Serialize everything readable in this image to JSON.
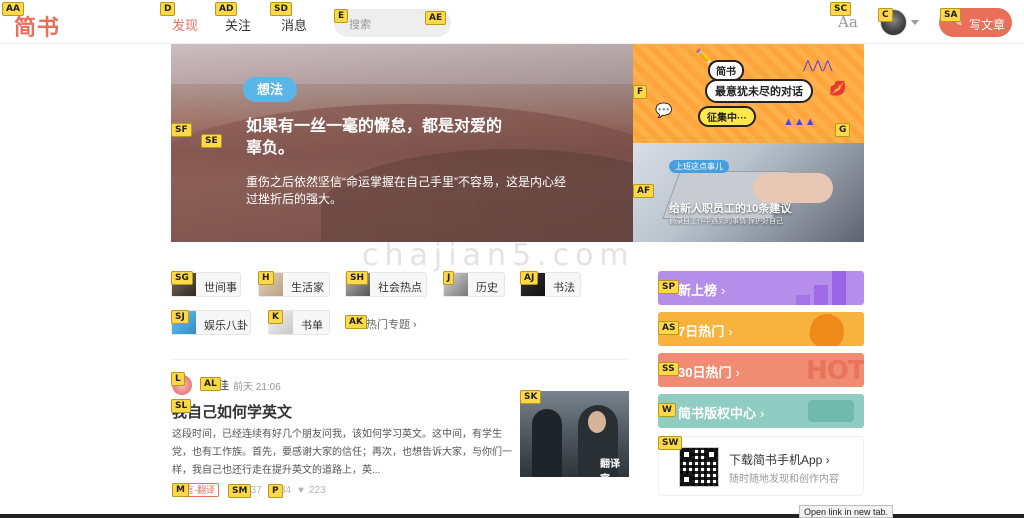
{
  "header": {
    "logo": "简书",
    "nav": {
      "discover": "发现",
      "follow": "关注",
      "messages": "消息"
    },
    "search": {
      "placeholder": "搜索"
    },
    "font_toggle": "Aa",
    "write_button": "写文章"
  },
  "hints": {
    "logo": "AA",
    "discover": "D",
    "follow": "AD",
    "messages": "SD",
    "search_input": "E",
    "search_btn": "AE",
    "font": "SC",
    "avatar": "C",
    "write": "SA",
    "banner_main_1": "SF",
    "banner_main_2": "SE",
    "banner_top_1": "F",
    "banner_top_2": "G",
    "banner_bot": "AF",
    "t1": "SG",
    "t2": "H",
    "t3": "SH",
    "t4": "J",
    "t5": "AJ",
    "t6": "SJ",
    "t7": "K",
    "more": "AK",
    "author_ava": "L",
    "author_name": "AL",
    "title": "SL",
    "tag": "M",
    "views": "SM",
    "comments": "P",
    "thumb": "SK",
    "r1": "SP",
    "r2": "AS",
    "r3": "SS",
    "r4": "W",
    "app": "SW"
  },
  "banner_main": {
    "tag": "想法",
    "title": "如果有一丝一毫的懈怠，都是对爱的辜负。",
    "subtitle": "重伤之后依然坚信“命运掌握在自己手里”不容易，这是内心经过挫折后的强大。"
  },
  "banner_top": {
    "badge": "简书",
    "headline": "最意犹未尽的对话",
    "status": "征集中···"
  },
  "banner_bottom": {
    "tag": "上班这点事儿",
    "title": "给新人职员工的10条建议",
    "subtitle": "摘录自工作中遇到的事情 保护好自己"
  },
  "topics": [
    {
      "label": "世间事"
    },
    {
      "label": "生活家"
    },
    {
      "label": "社会热点"
    },
    {
      "label": "历史"
    },
    {
      "label": "书法"
    },
    {
      "label": "娱乐八卦"
    },
    {
      "label": "书单"
    }
  ],
  "more_topics": "热门专题 ›",
  "article": {
    "author": "佳",
    "time": "前天 21:06",
    "title": "我自己如何学英文",
    "excerpt": "这段时间，已经连续有好几个朋友问我，该如何学习英文。这中间，有学生党，也有工作族。首先，要感谢大家的信任；再次，也想告诉大家，与你们一样，我自己也还行走在提升英文的道路上，英...",
    "tag": "语言·翻译",
    "views": "537",
    "comments": "34",
    "likes": "223",
    "thumb_caption": "翻译官"
  },
  "rankings": [
    {
      "label": "新上榜",
      "color": "#b48ee8"
    },
    {
      "label": "7日热门",
      "color": "#f8b23e"
    },
    {
      "label": "30日热门",
      "color": "#f08c74"
    },
    {
      "label": "简书版权中心",
      "color": "#8fcdc2"
    }
  ],
  "rank_decor": {
    "hot": "HOT"
  },
  "app_download": {
    "title": "下载简书手机App ›",
    "subtitle": "随时随地发现和创作内容"
  },
  "watermark": "chajian5.com",
  "status_bar": "Open link in new tab.",
  "colors": {
    "brand": "#ea6f5a",
    "tag_blue": "#5ab5e8"
  }
}
